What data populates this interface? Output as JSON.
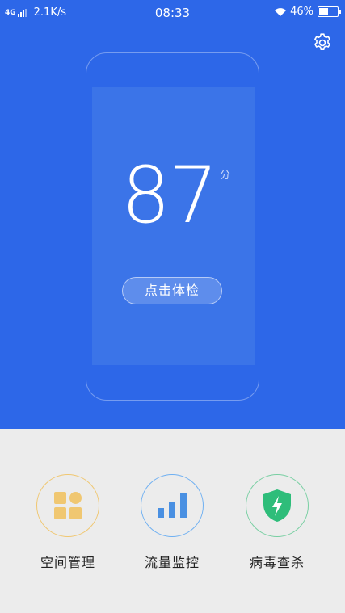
{
  "status_bar": {
    "network": "4G",
    "speed": "2.1K/s",
    "time": "08:33",
    "battery": "46%",
    "battery_level": 0.46
  },
  "header": {
    "settings_icon": "gear-icon"
  },
  "score": {
    "value": "87",
    "unit": "分"
  },
  "check_button": {
    "label": "点击体检"
  },
  "features": [
    {
      "label": "空间管理",
      "icon": "grid-icon",
      "color": "#f0c771"
    },
    {
      "label": "流量监控",
      "icon": "bar-chart-icon",
      "color": "#4a90e2"
    },
    {
      "label": "病毒查杀",
      "icon": "shield-bolt-icon",
      "color": "#2ebd7a"
    }
  ],
  "colors": {
    "primary": "#2d67e8",
    "background": "#ececec"
  }
}
